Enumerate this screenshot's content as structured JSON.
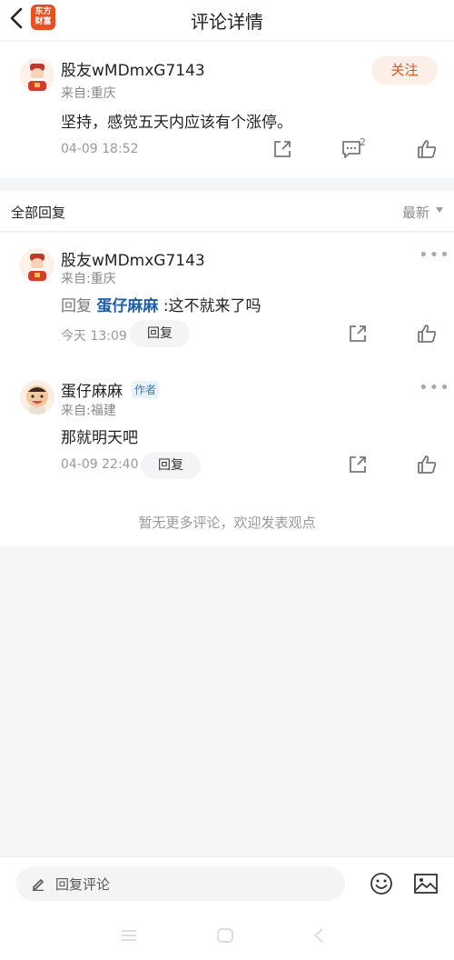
{
  "header": {
    "title": "评论详情",
    "logo_line1": "东方",
    "logo_line2": "财富"
  },
  "post": {
    "username": "股友wMDmxG7143",
    "location": "来自:重庆",
    "content": "坚持，感觉五天内应该有个涨停。",
    "time": "04-09 18:52",
    "follow_label": "关注",
    "comment_count": "2"
  },
  "section": {
    "title": "全部回复",
    "sort_label": "最新"
  },
  "replies": [
    {
      "username": "股友wMDmxG7143",
      "location": "来自:重庆",
      "prefix": "回复",
      "mention": "蛋仔麻麻",
      "text": ":这不就来了吗",
      "time": "今天 13:09",
      "reply_label": "回复"
    },
    {
      "username": "蛋仔麻麻",
      "badge": "作者",
      "location": "来自:福建",
      "text": "那就明天吧",
      "time": "04-09 22:40",
      "reply_label": "回复"
    }
  ],
  "end_note": "暂无更多评论，欢迎发表观点",
  "bottom": {
    "input_placeholder": "回复评论"
  },
  "colors": {
    "accent": "#e8501f",
    "link": "#1f5fa8"
  }
}
